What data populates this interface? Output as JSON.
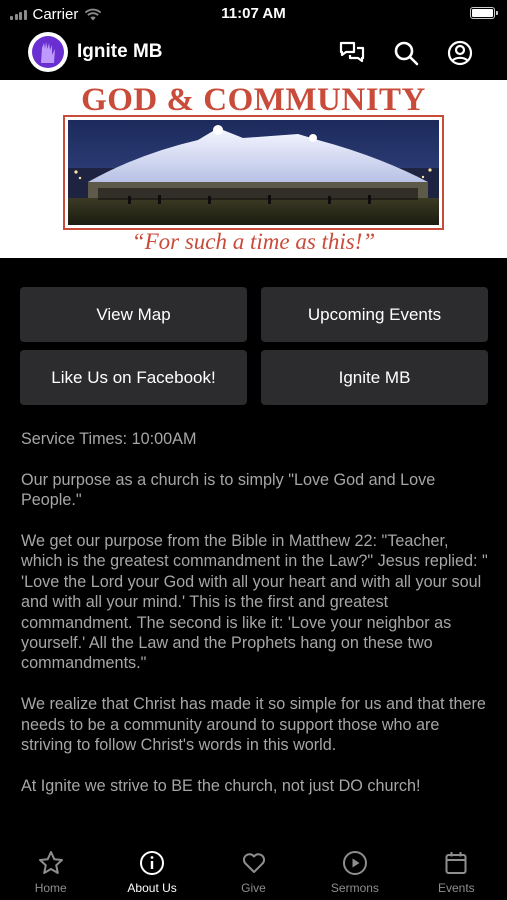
{
  "status_bar": {
    "carrier": "Carrier",
    "time": "11:07 AM"
  },
  "header": {
    "title": "Ignite MB",
    "icons": [
      "chat-icon",
      "search-icon",
      "profile-icon"
    ]
  },
  "banner": {
    "title": "GOD & COMMUNITY",
    "tagline": "“For such a time as this!”"
  },
  "buttons": [
    {
      "label": "View Map"
    },
    {
      "label": "Upcoming Events"
    },
    {
      "label": "Like Us on Facebook!"
    },
    {
      "label": "Ignite MB"
    }
  ],
  "content": {
    "paragraphs": [
      "Service Times: 10:00AM",
      "Our purpose as a church is to simply \"Love God and Love People.\"",
      "We get our purpose from the Bible in Matthew 22: \"Teacher, which is the greatest commandment in the Law?\" Jesus replied: \" 'Love the Lord your God with all your heart and with all your soul and with all your mind.' This is the first and greatest commandment. The second is like it: 'Love your neighbor as yourself.' All the Law and the Prophets hang on these two commandments.\"",
      "We realize that Christ has made it so simple for us and that there needs to be a community around to support those who are striving to follow Christ's words in this world.",
      "At Ignite we strive to BE the church, not just DO church!"
    ]
  },
  "tabs": [
    {
      "label": "Home",
      "icon": "star-icon",
      "active": false
    },
    {
      "label": "About Us",
      "icon": "info-icon",
      "active": true
    },
    {
      "label": "Give",
      "icon": "heart-icon",
      "active": false
    },
    {
      "label": "Sermons",
      "icon": "play-icon",
      "active": false
    },
    {
      "label": "Events",
      "icon": "calendar-icon",
      "active": false
    }
  ],
  "colors": {
    "accent_red": "#c94b3a",
    "button_bg": "#2c2c2e",
    "body_text": "#a6a6a6",
    "logo_purple": "#7b3fe4"
  }
}
